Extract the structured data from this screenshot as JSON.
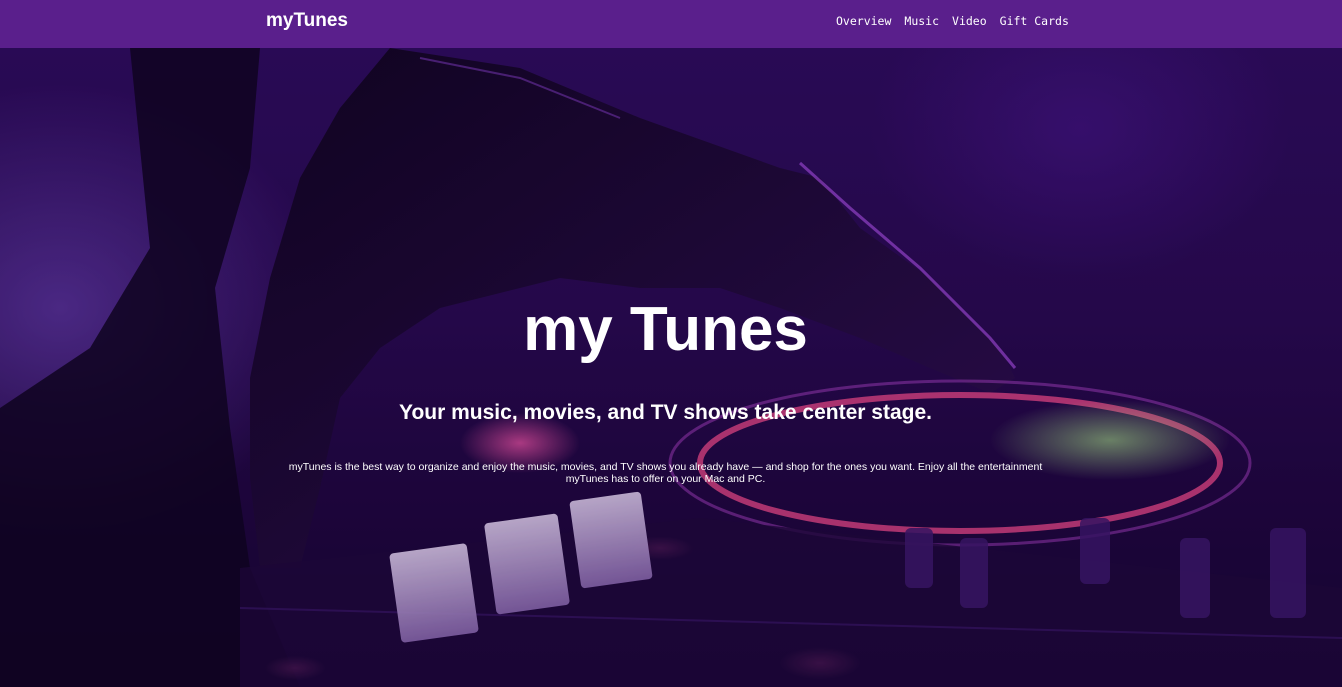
{
  "header": {
    "brand": "myTunes",
    "nav": [
      {
        "label": "Overview"
      },
      {
        "label": "Music"
      },
      {
        "label": "Video"
      },
      {
        "label": "Gift Cards"
      }
    ]
  },
  "hero": {
    "title": "my Tunes",
    "subtitle": "Your music, movies, and TV shows take center stage.",
    "body": "myTunes is the best way to organize and enjoy the music, movies, and TV shows you already have — and shop for the ones you want. Enjoy all the entertainment myTunes has to offer on your Mac and PC.",
    "background_image": "dj-turntable-hand-photo"
  },
  "colors": {
    "navbar": "#5a1f8c",
    "text": "#ffffff",
    "hero_tint": "#2a0c57"
  }
}
